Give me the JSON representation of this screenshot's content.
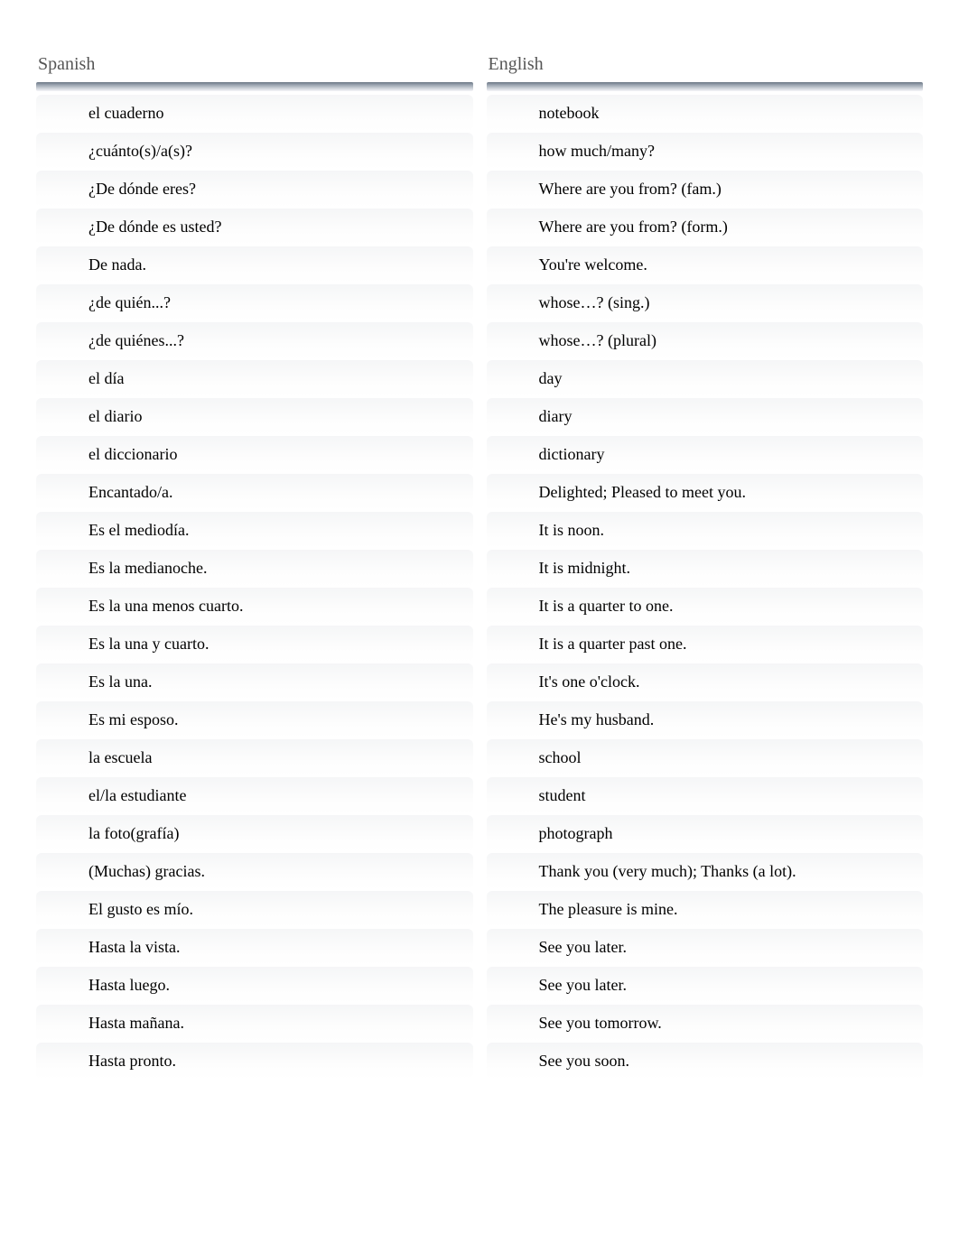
{
  "headers": {
    "left": "Spanish",
    "right": "English"
  },
  "rows": [
    {
      "spanish": "el cuaderno",
      "english": "notebook"
    },
    {
      "spanish": "¿cuánto(s)/a(s)?",
      "english": "how much/many?"
    },
    {
      "spanish": "¿De dónde eres?",
      "english": "Where are you from? (fam.)"
    },
    {
      "spanish": "¿De dónde es usted?",
      "english": "Where are you from? (form.)"
    },
    {
      "spanish": "De nada.",
      "english": "You're welcome."
    },
    {
      "spanish": "¿de quién...?",
      "english": "whose…? (sing.)"
    },
    {
      "spanish": "¿de quiénes...?",
      "english": "whose…? (plural)"
    },
    {
      "spanish": "el día",
      "english": "day"
    },
    {
      "spanish": "el diario",
      "english": "diary"
    },
    {
      "spanish": "el diccionario",
      "english": "dictionary"
    },
    {
      "spanish": "Encantado/a.",
      "english": "Delighted; Pleased to meet you."
    },
    {
      "spanish": "Es el mediodía.",
      "english": "It is noon."
    },
    {
      "spanish": "Es la medianoche.",
      "english": "It is midnight."
    },
    {
      "spanish": "Es la una menos cuarto.",
      "english": "It is a quarter to one."
    },
    {
      "spanish": "Es la una y cuarto.",
      "english": "It is a quarter past one."
    },
    {
      "spanish": "Es la una.",
      "english": "It's one o'clock."
    },
    {
      "spanish": "Es mi esposo.",
      "english": "He's my husband."
    },
    {
      "spanish": "la escuela",
      "english": "school"
    },
    {
      "spanish": "el/la estudiante",
      "english": "student"
    },
    {
      "spanish": "la foto(grafía)",
      "english": "photograph"
    },
    {
      "spanish": "(Muchas) gracias.",
      "english": "Thank you (very much); Thanks (a lot)."
    },
    {
      "spanish": "El gusto es mío.",
      "english": "The pleasure is mine."
    },
    {
      "spanish": "Hasta la vista.",
      "english": "See you later."
    },
    {
      "spanish": "Hasta luego.",
      "english": "See you later."
    },
    {
      "spanish": "Hasta mañana.",
      "english": "See you tomorrow."
    },
    {
      "spanish": "Hasta pronto.",
      "english": "See you soon."
    }
  ]
}
